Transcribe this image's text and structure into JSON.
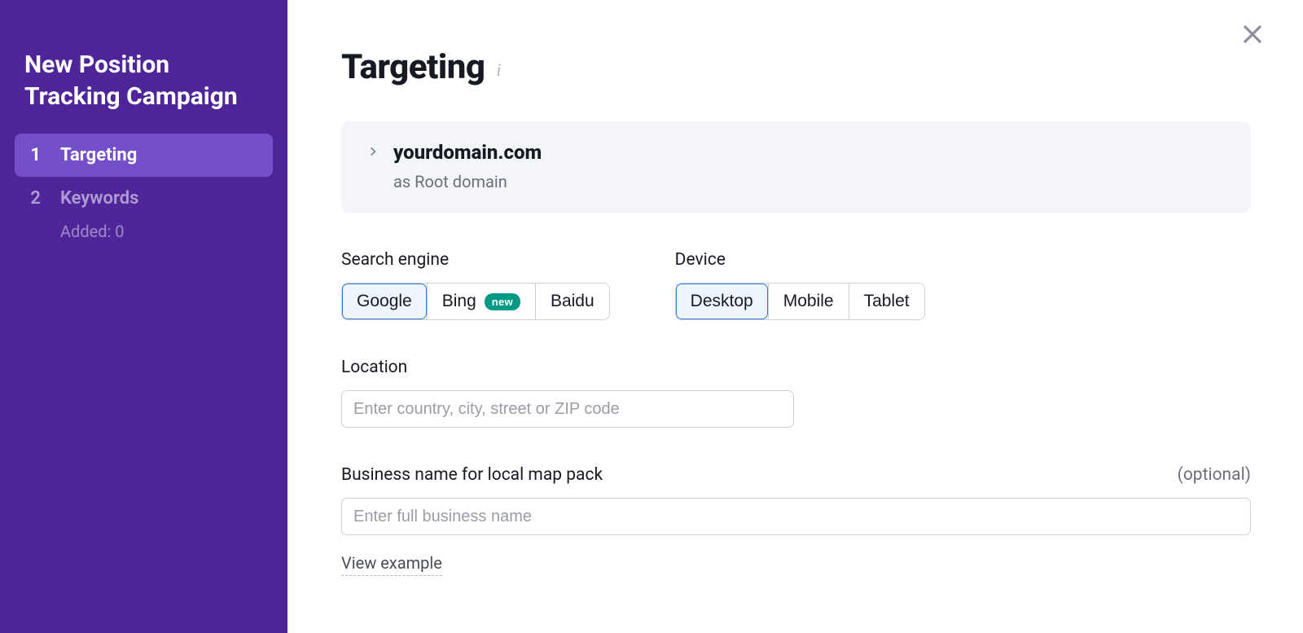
{
  "sidebar": {
    "title": "New Position Tracking Campaign",
    "steps": [
      {
        "num": "1",
        "label": "Targeting",
        "active": true
      },
      {
        "num": "2",
        "label": "Keywords",
        "sub": "Added: 0",
        "active": false
      }
    ]
  },
  "header": {
    "title": "Targeting"
  },
  "domain_card": {
    "domain": "yourdomain.com",
    "sub": "as Root domain"
  },
  "search_engine": {
    "label": "Search engine",
    "options": [
      {
        "label": "Google",
        "selected": true
      },
      {
        "label": "Bing",
        "badge": "new"
      },
      {
        "label": "Baidu"
      }
    ]
  },
  "device": {
    "label": "Device",
    "options": [
      {
        "label": "Desktop",
        "selected": true
      },
      {
        "label": "Mobile"
      },
      {
        "label": "Tablet"
      }
    ]
  },
  "location": {
    "label": "Location",
    "placeholder": "Enter country, city, street or ZIP code"
  },
  "business": {
    "label": "Business name for local map pack",
    "optional": "(optional)",
    "placeholder": "Enter full business name",
    "view_example": "View example"
  }
}
